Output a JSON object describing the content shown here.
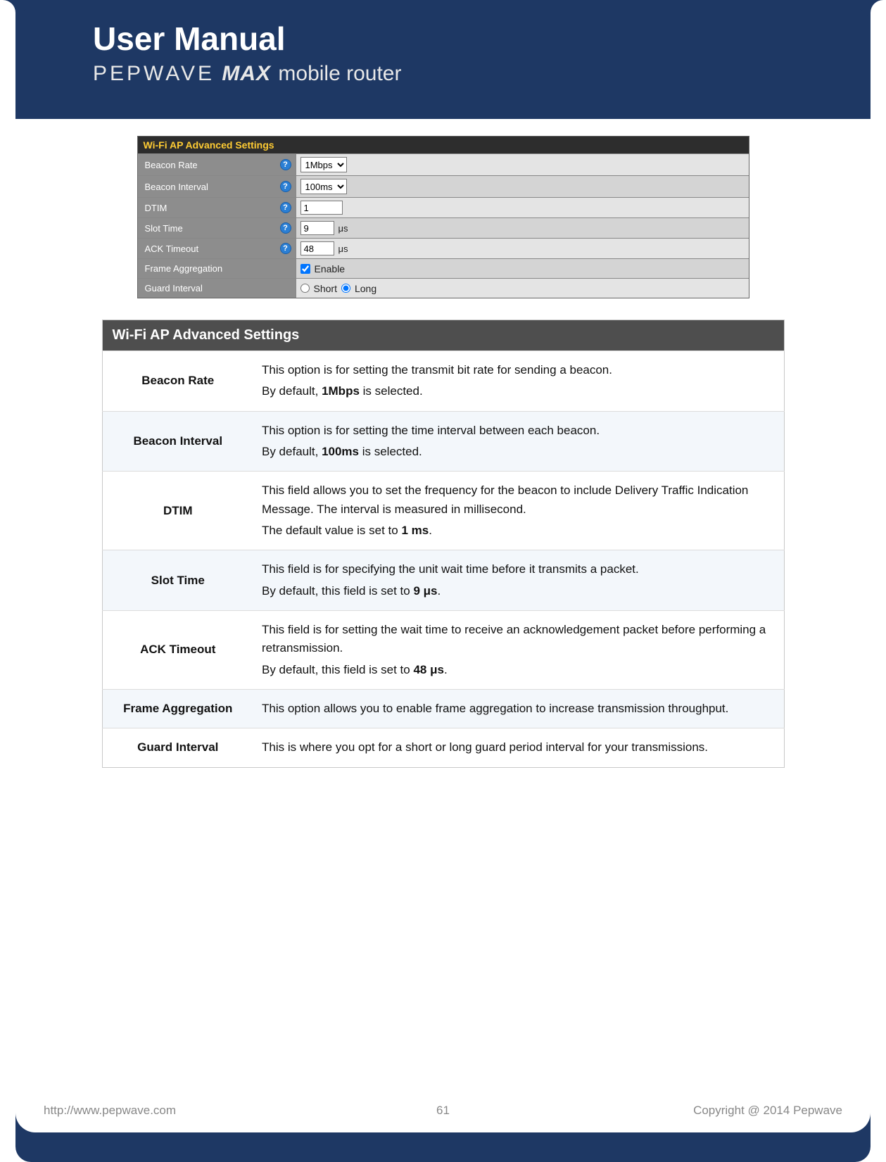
{
  "banner": {
    "title": "User Manual",
    "brand": "PEPWAVE",
    "max": "MAX",
    "tag": "mobile router"
  },
  "ui": {
    "header": "Wi-Fi AP Advanced Settings",
    "rows": {
      "beacon_rate": {
        "label": "Beacon Rate",
        "value": "1Mbps"
      },
      "beacon_interval": {
        "label": "Beacon Interval",
        "value": "100ms"
      },
      "dtim": {
        "label": "DTIM",
        "value": "1"
      },
      "slot_time": {
        "label": "Slot Time",
        "value": "9",
        "unit": "μs"
      },
      "ack_timeout": {
        "label": "ACK Timeout",
        "value": "48",
        "unit": "μs"
      },
      "frame_agg": {
        "label": "Frame Aggregation",
        "enable": "Enable"
      },
      "guard": {
        "label": "Guard Interval",
        "short": "Short",
        "long": "Long"
      }
    }
  },
  "desc": {
    "header": "Wi-Fi AP Advanced Settings",
    "rows": [
      {
        "term": "Beacon Rate",
        "p1": "This option is for setting the transmit bit rate for sending a beacon.",
        "p2a": "By default, ",
        "p2b": "1Mbps",
        "p2c": " is selected."
      },
      {
        "term": "Beacon Interval",
        "p1": "This option is for setting the time interval between each beacon.",
        "p2a": "By default, ",
        "p2b": "100ms",
        "p2c": " is selected."
      },
      {
        "term": "DTIM",
        "p1": "This field allows you to set the frequency for the beacon to include Delivery Traffic Indication Message. The interval is measured in millisecond.",
        "p2a": "The default value is set to ",
        "p2b": "1 ms",
        "p2c": "."
      },
      {
        "term": "Slot Time",
        "p1": "This field is for specifying the unit wait time before it transmits a packet.",
        "p2a": "By default, this field is set to ",
        "p2b": "9 μs",
        "p2c": "."
      },
      {
        "term": "ACK Timeout",
        "p1": "This field is for setting the wait time to receive an acknowledgement packet before performing a retransmission.",
        "p2a": "By default, this field is set to ",
        "p2b": "48 μs",
        "p2c": "."
      },
      {
        "term": "Frame Aggregation",
        "p1": "This option allows you to enable frame aggregation to increase transmission throughput."
      },
      {
        "term": "Guard Interval",
        "p1": "This is where you opt for a short or long guard period interval for your transmissions."
      }
    ]
  },
  "footer": {
    "url": "http://www.pepwave.com",
    "page": "61",
    "copy": "Copyright @ 2014 Pepwave"
  }
}
